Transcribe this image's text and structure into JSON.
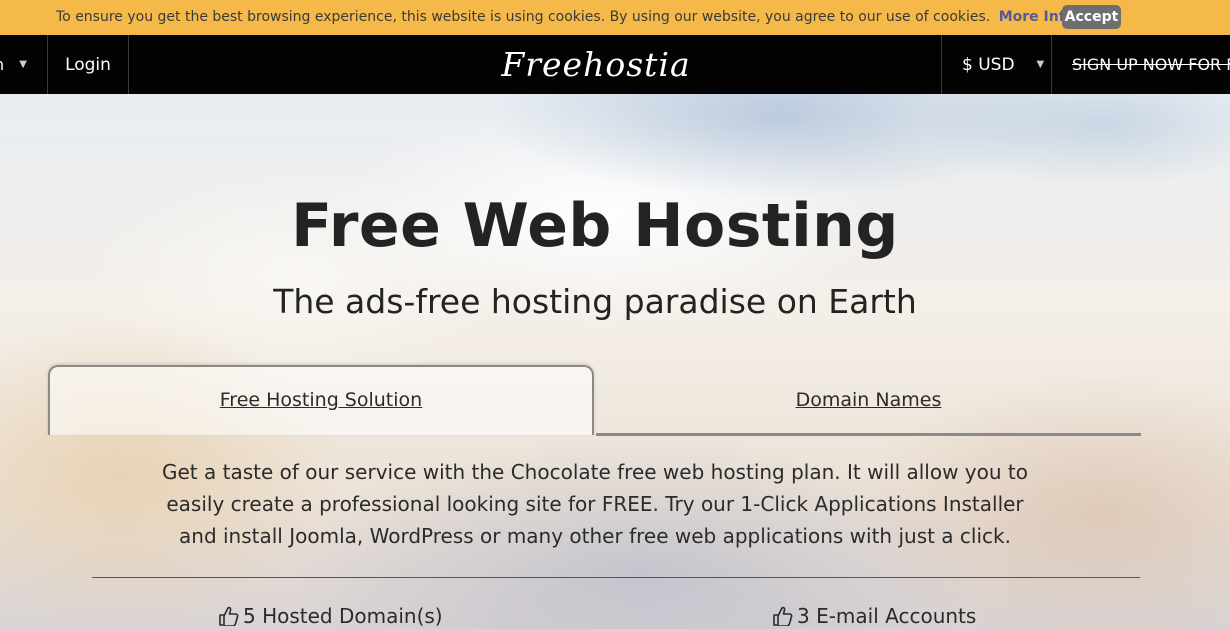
{
  "cookie_bar": {
    "text": "To ensure you get the best browsing experience, this website is using cookies. By using our website, you agree to our use of cookies.",
    "more_info": "More Info.",
    "accept": "Accept"
  },
  "nav": {
    "language": "n",
    "login": "Login",
    "logo": "Freehostia",
    "currency": "$ USD",
    "signup": "SIGN UP NOW FOR FR"
  },
  "hero": {
    "title": "Free Web Hosting",
    "subtitle": "The ads-free hosting paradise on Earth"
  },
  "tabs": [
    {
      "label": "Free Hosting Solution",
      "active": true
    },
    {
      "label": "Domain Names",
      "active": false
    }
  ],
  "description": "Get a taste of our service with the Chocolate free web hosting plan. It will allow you to easily create a professional looking site for FREE. Try our 1-Click Applications Installer and install Joomla, WordPress or many other free web applications with just a click.",
  "features": [
    {
      "label": "5 Hosted Domain(s)",
      "icon": "thumbs-up-icon"
    },
    {
      "label": "3 E-mail Accounts",
      "icon": "thumbs-up-icon"
    }
  ],
  "colors": {
    "cookie_bar": "#f5b94a",
    "nav_bg": "#030303",
    "accept_button": "#6e6e6e",
    "more_info_link": "#555a9a"
  }
}
